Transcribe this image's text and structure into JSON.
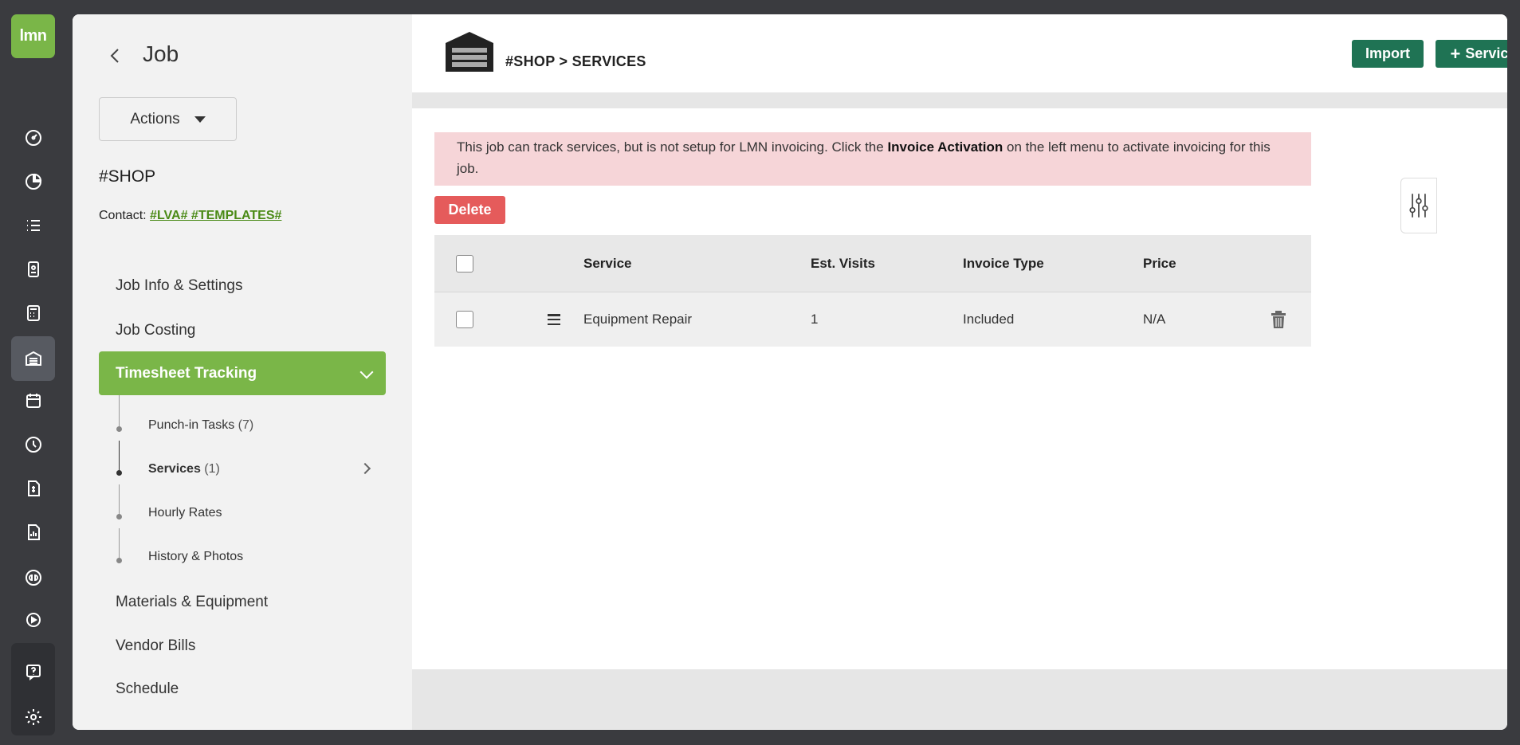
{
  "logo": {
    "text": "lmn"
  },
  "rail_icons": [
    "dashboard-icon",
    "pie-chart-icon",
    "list-icon",
    "contacts-icon",
    "calculator-icon",
    "garage-icon",
    "calendar-icon",
    "clock-icon",
    "invoice-icon",
    "report-icon",
    "quickbooks-icon",
    "play-icon",
    "help-icon",
    "settings-icon"
  ],
  "side": {
    "title": "Job",
    "actions_label": "Actions",
    "job_name": "#SHOP",
    "contact_label": "Contact:",
    "contact_value": "#LVA# #TEMPLATES#",
    "menu": {
      "job_info": "Job Info & Settings",
      "job_costing": "Job Costing",
      "timesheet": "Timesheet Tracking",
      "materials": "Materials & Equipment",
      "vendor_bills": "Vendor Bills",
      "schedule": "Schedule"
    },
    "sub": {
      "punch_label": "Punch-in Tasks",
      "punch_count": "(7)",
      "services_label": "Services",
      "services_count": "(1)",
      "hourly": "Hourly Rates",
      "history": "History & Photos"
    }
  },
  "header": {
    "breadcrumb": "#SHOP > SERVICES",
    "import_label": "Import",
    "service_label": "Service",
    "service_icon": "+"
  },
  "alert": {
    "pre": "This job can track services, but is not setup for LMN invoicing. Click the ",
    "bold": "Invoice Activation",
    "post": " on the left menu to activate invoicing for this job."
  },
  "delete_label": "Delete",
  "table": {
    "columns": {
      "service": "Service",
      "visits": "Est. Visits",
      "invoice_type": "Invoice Type",
      "price": "Price"
    },
    "rows": [
      {
        "service": "Equipment Repair",
        "visits": "1",
        "invoice_type": "Included",
        "price": "N/A"
      }
    ]
  },
  "colors": {
    "brand_green": "#7ab648",
    "button_green": "#1f7354",
    "delete_red": "#e55b5b",
    "alert_bg": "#f6d5d8"
  }
}
